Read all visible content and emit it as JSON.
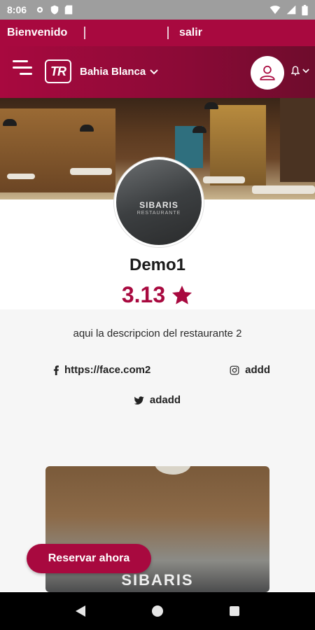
{
  "status_bar": {
    "time": "8:06"
  },
  "welcome_bar": {
    "welcome_text": "Bienvenido",
    "logout_text": "salir"
  },
  "header": {
    "logo_text": "TR",
    "city": "Bahia Blanca"
  },
  "restaurant": {
    "name": "Demo1",
    "rating": "3.13",
    "description": "aqui la descripcion del restaurante 2",
    "facebook": "https://face.com2",
    "instagram": "addd",
    "twitter": "adadd",
    "photo_sign": "SIBARIS",
    "photo_sign_sub": "RESTAURANTE",
    "card_sign": "SIBARIS"
  },
  "actions": {
    "reserve_label": "Reservar ahora"
  },
  "colors": {
    "brand": "#a8093f",
    "brand_dark": "#6e0c2c"
  }
}
